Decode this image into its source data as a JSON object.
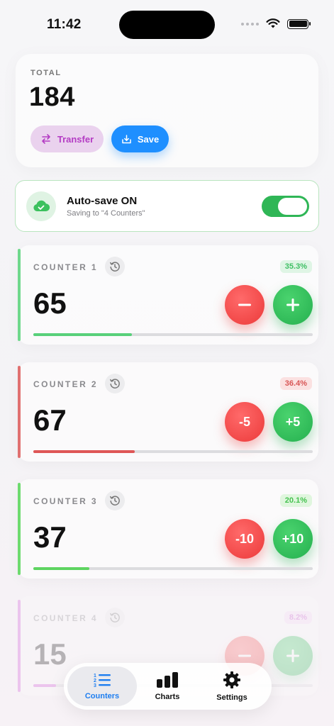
{
  "status_bar": {
    "time": "11:42"
  },
  "total": {
    "label": "TOTAL",
    "value": "184"
  },
  "actions": {
    "transfer_label": "Transfer",
    "save_label": "Save"
  },
  "autosave": {
    "title": "Auto-save ON",
    "subtitle": "Saving to \"4 Counters\"",
    "enabled": true
  },
  "counters": [
    {
      "name": "COUNTER 1",
      "value": "65",
      "percent": "35.3%",
      "minus_label": "",
      "plus_label": "",
      "progress": 0.353,
      "color": "#58d07a",
      "badge_bg": "#dff5e5",
      "badge_fg": "#3fbf64"
    },
    {
      "name": "COUNTER 2",
      "value": "67",
      "percent": "36.4%",
      "minus_label": "-5",
      "plus_label": "+5",
      "progress": 0.364,
      "color": "#de5656",
      "badge_bg": "#fbe1e1",
      "badge_fg": "#d85555"
    },
    {
      "name": "COUNTER 3",
      "value": "37",
      "percent": "20.1%",
      "minus_label": "-10",
      "plus_label": "+10",
      "progress": 0.201,
      "color": "#5ed461",
      "badge_bg": "#e0f6de",
      "badge_fg": "#45c24f"
    },
    {
      "name": "COUNTER 4",
      "value": "15",
      "percent": "8.2%",
      "minus_label": "",
      "plus_label": "",
      "progress": 0.082,
      "color": "#d04fd6",
      "badge_bg": "#f6dcf7",
      "badge_fg": "#c64ccc"
    }
  ],
  "tabs": [
    {
      "label": "Counters",
      "icon": "numbered-list-icon",
      "active": true
    },
    {
      "label": "Charts",
      "icon": "bar-chart-icon",
      "active": false
    },
    {
      "label": "Settings",
      "icon": "gear-icon",
      "active": false
    }
  ],
  "colors": {
    "accent_blue": "#1e8fff",
    "transfer_purple": "#b43cc4",
    "minus_red": "#ec3a3a",
    "plus_green": "#25b04f",
    "toggle_green": "#2fb656"
  }
}
